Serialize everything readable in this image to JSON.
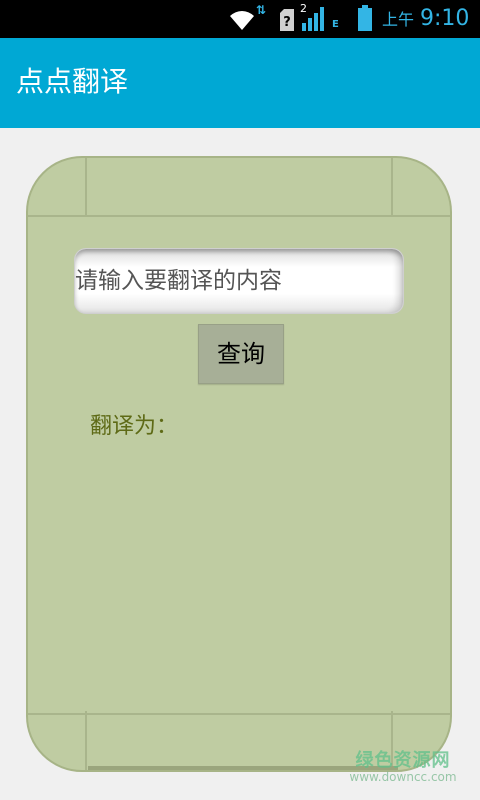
{
  "status_bar": {
    "sim_index": "2",
    "network_type": "E",
    "ampm": "上午",
    "time": "9:10",
    "icons": [
      "wifi-icon",
      "data-arrows-icon",
      "no-sim-icon",
      "signal-icon",
      "battery-icon"
    ],
    "accent_color": "#33b5e5"
  },
  "action_bar": {
    "title": "点点翻译",
    "color": "#00a8d4"
  },
  "card": {
    "color": "#bfcca2",
    "input": {
      "value": "",
      "placeholder": "请输入要翻译的内容"
    },
    "query_button": "查询",
    "result_label": "翻译为："
  },
  "watermark": {
    "main": "绿色资源网",
    "url": "www.downcc.com"
  }
}
